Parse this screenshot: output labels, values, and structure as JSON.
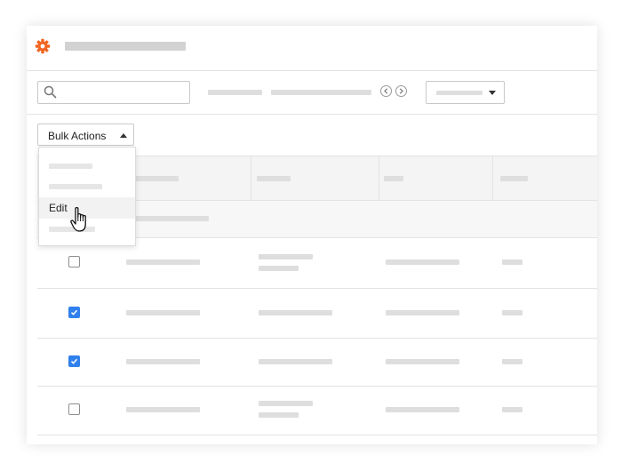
{
  "toolbar": {
    "search": {
      "value": "",
      "placeholder": "",
      "icon": "search-icon"
    },
    "pagination": {
      "prev_icon": "chevron-left-icon",
      "next_icon": "chevron-right-icon"
    },
    "filter_select": {
      "icon": "caret-down-icon"
    }
  },
  "bulk_actions": {
    "label": "Bulk Actions",
    "expanded": true,
    "menu_items": [
      {
        "label": ""
      },
      {
        "label": ""
      },
      {
        "label": "Edit",
        "hovered": true
      },
      {
        "label": ""
      }
    ]
  },
  "table": {
    "rows": [
      {
        "checked": false
      },
      {
        "checked": true
      },
      {
        "checked": true
      },
      {
        "checked": false
      }
    ]
  },
  "colors": {
    "accent": "#2f80ed",
    "logo": "#f26522",
    "placeholder": "#dedede",
    "border": "#e3e3e3"
  }
}
